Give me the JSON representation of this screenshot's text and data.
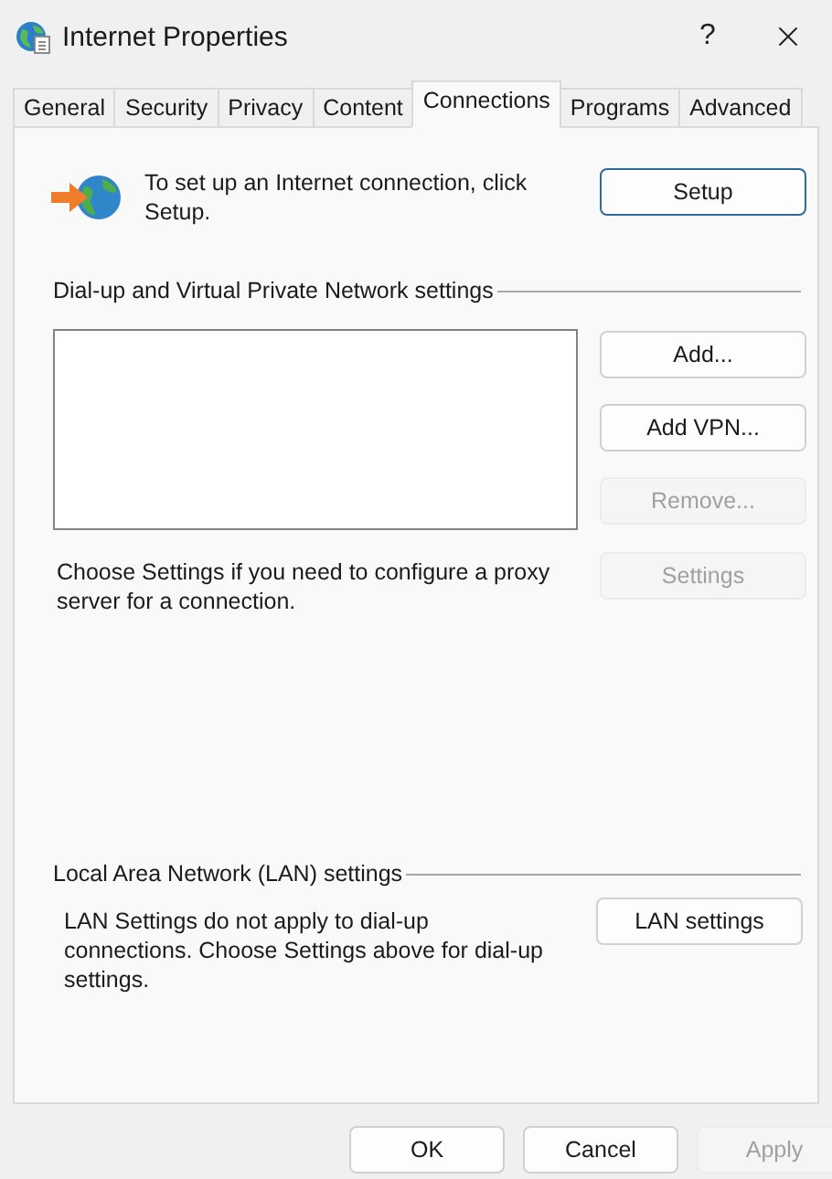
{
  "window": {
    "title": "Internet Properties",
    "help": "?"
  },
  "tabs": [
    {
      "label": "General",
      "selected": false
    },
    {
      "label": "Security",
      "selected": false
    },
    {
      "label": "Privacy",
      "selected": false
    },
    {
      "label": "Content",
      "selected": false
    },
    {
      "label": "Connections",
      "selected": true
    },
    {
      "label": "Programs",
      "selected": false
    },
    {
      "label": "Advanced",
      "selected": false
    }
  ],
  "setup": {
    "text": "To set up an Internet connection, click Setup.",
    "button": {
      "label": "Setup",
      "default": true,
      "disabled": false
    }
  },
  "dialup": {
    "heading": "Dial-up and Virtual Private Network settings",
    "buttons": [
      {
        "label": "Add...",
        "disabled": false
      },
      {
        "label": "Add VPN...",
        "disabled": false
      },
      {
        "label": "Remove...",
        "disabled": true
      }
    ],
    "proxy_text": "Choose Settings if you need to configure a proxy server for a connection.",
    "settings_button": {
      "label": "Settings",
      "disabled": true
    }
  },
  "lan": {
    "heading": "Local Area Network (LAN) settings",
    "text": "LAN Settings do not apply to dial-up connections. Choose Settings above for dial-up settings.",
    "button": {
      "label": "LAN settings",
      "disabled": false
    }
  },
  "footer": [
    {
      "label": "OK",
      "disabled": false
    },
    {
      "label": "Cancel",
      "disabled": false
    },
    {
      "label": "Apply",
      "disabled": true
    }
  ]
}
